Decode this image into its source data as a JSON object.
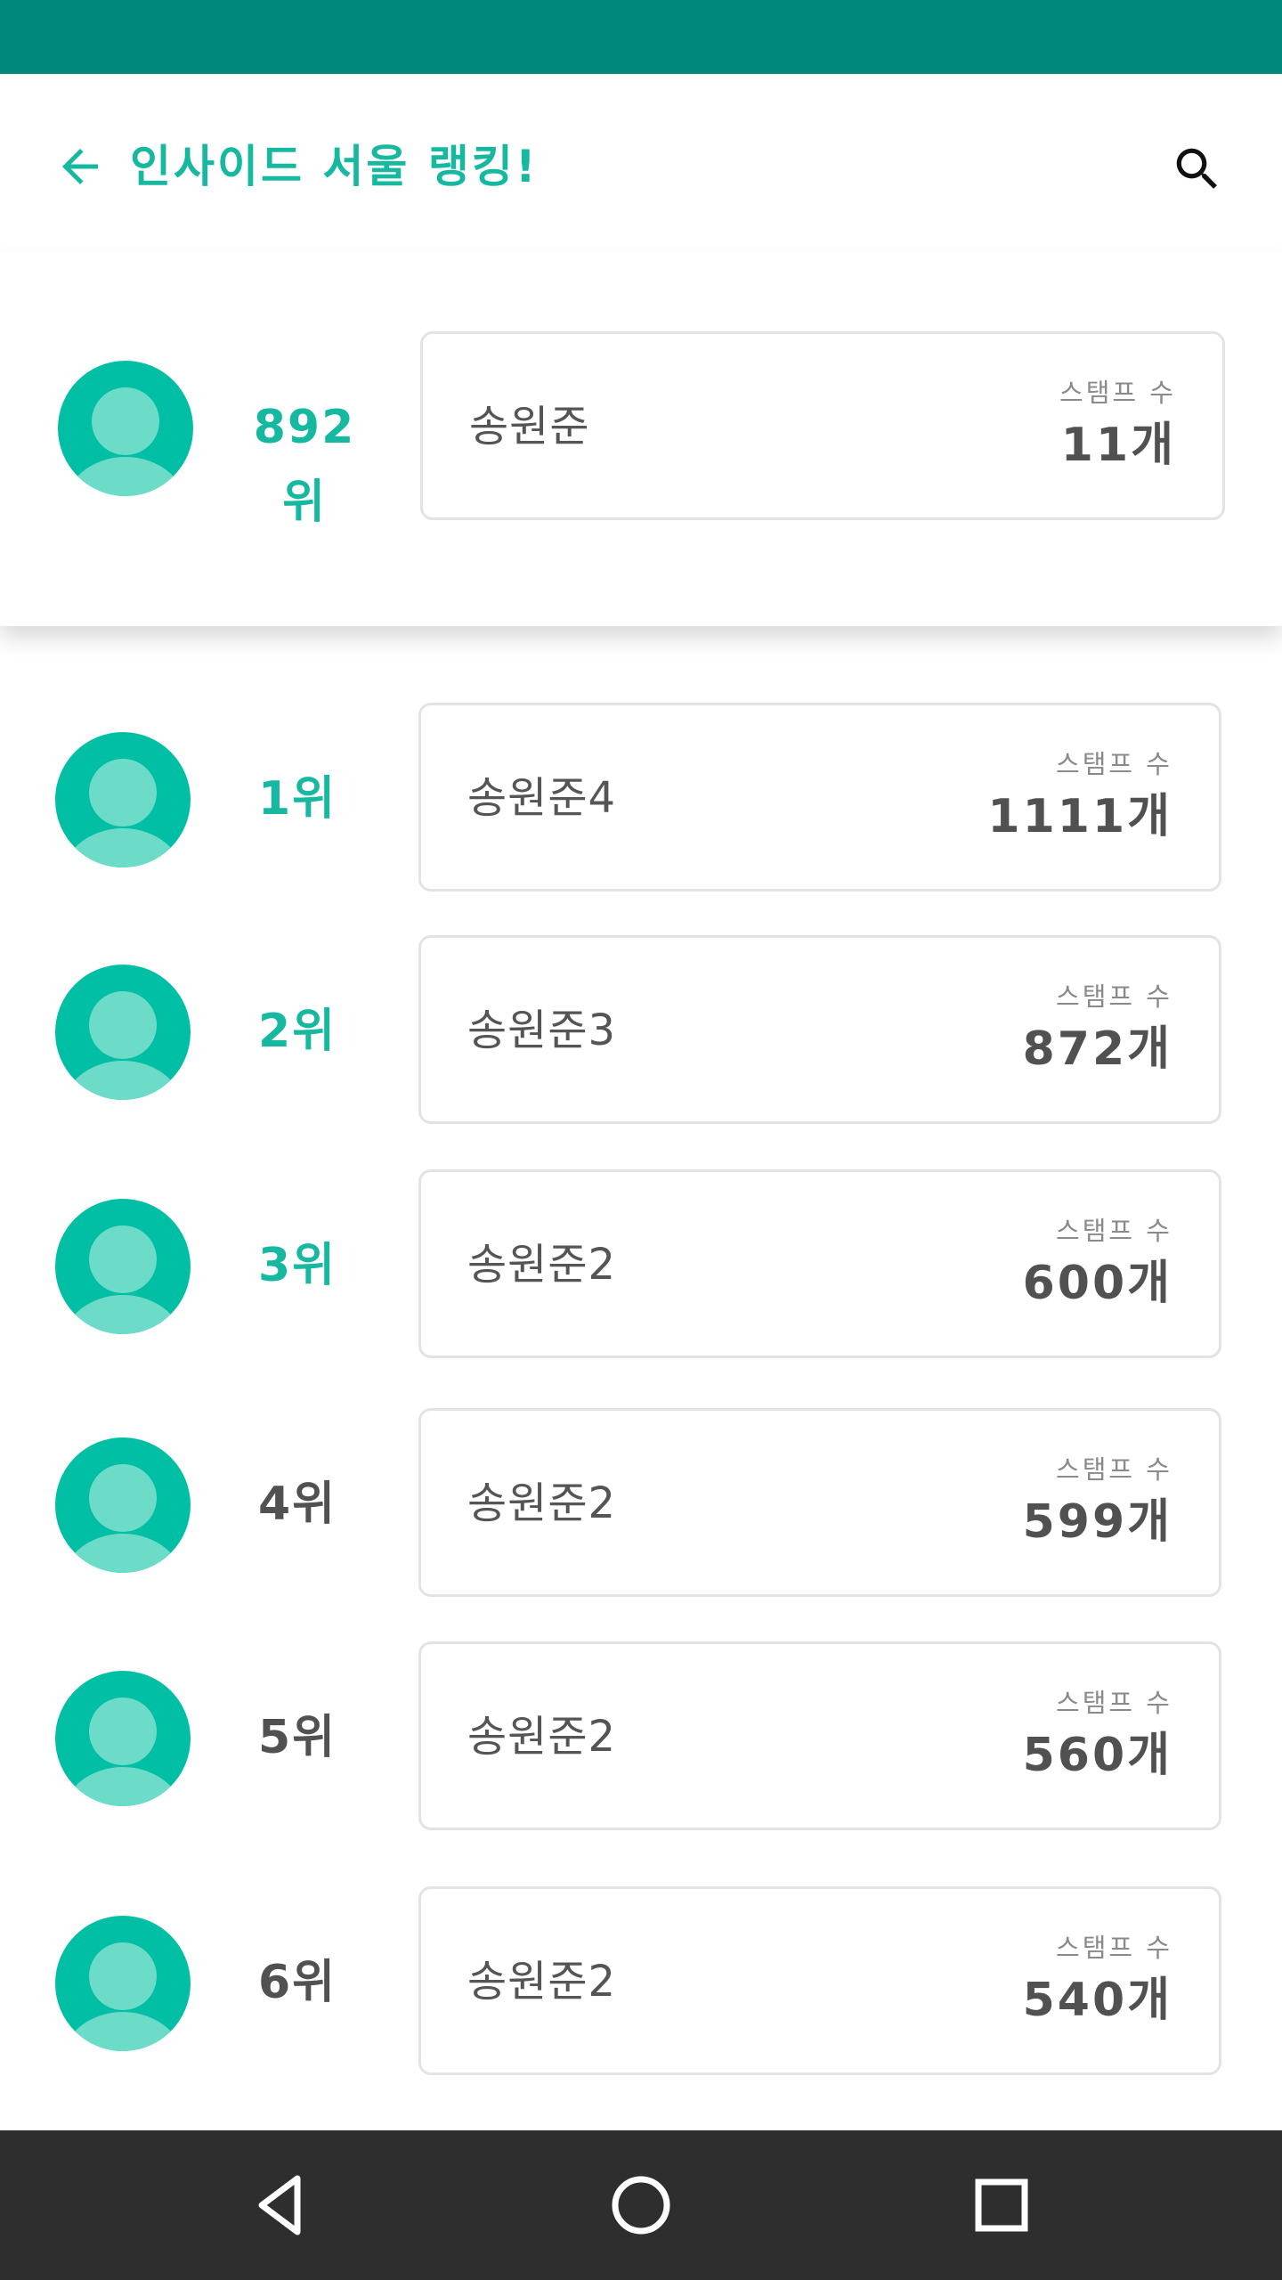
{
  "app_bar": {
    "title": "인사이드 서울 랭킹!",
    "back_icon": "arrow-back-icon",
    "search_icon": "search-icon"
  },
  "my_rank": {
    "rank": "892위",
    "name": "송원준",
    "stamp_label": "스탬프 수",
    "stamp_count": "11개"
  },
  "ranking": [
    {
      "rank": "1위",
      "name": "송원준4",
      "stamp_label": "스탬프 수",
      "stamp_count": "1111개",
      "highlight": true
    },
    {
      "rank": "2위",
      "name": "송원준3",
      "stamp_label": "스탬프 수",
      "stamp_count": "872개",
      "highlight": true
    },
    {
      "rank": "3위",
      "name": "송원준2",
      "stamp_label": "스탬프 수",
      "stamp_count": "600개",
      "highlight": true
    },
    {
      "rank": "4위",
      "name": "송원준2",
      "stamp_label": "스탬프 수",
      "stamp_count": "599개",
      "highlight": false
    },
    {
      "rank": "5위",
      "name": "송원준2",
      "stamp_label": "스탬프 수",
      "stamp_count": "560개",
      "highlight": false
    },
    {
      "rank": "6위",
      "name": "송원준2",
      "stamp_label": "스탬프 수",
      "stamp_count": "540개",
      "highlight": false
    }
  ],
  "nav": {
    "back_icon": "triangle-back-icon",
    "home_icon": "circle-home-icon",
    "recents_icon": "square-recents-icon"
  },
  "colors": {
    "status_bar": "#00897b",
    "accent": "#17b8a0",
    "avatar_bg": "#00bfa5",
    "avatar_fg": "#6cdcc9",
    "nav_bar": "#2e2e2e"
  }
}
